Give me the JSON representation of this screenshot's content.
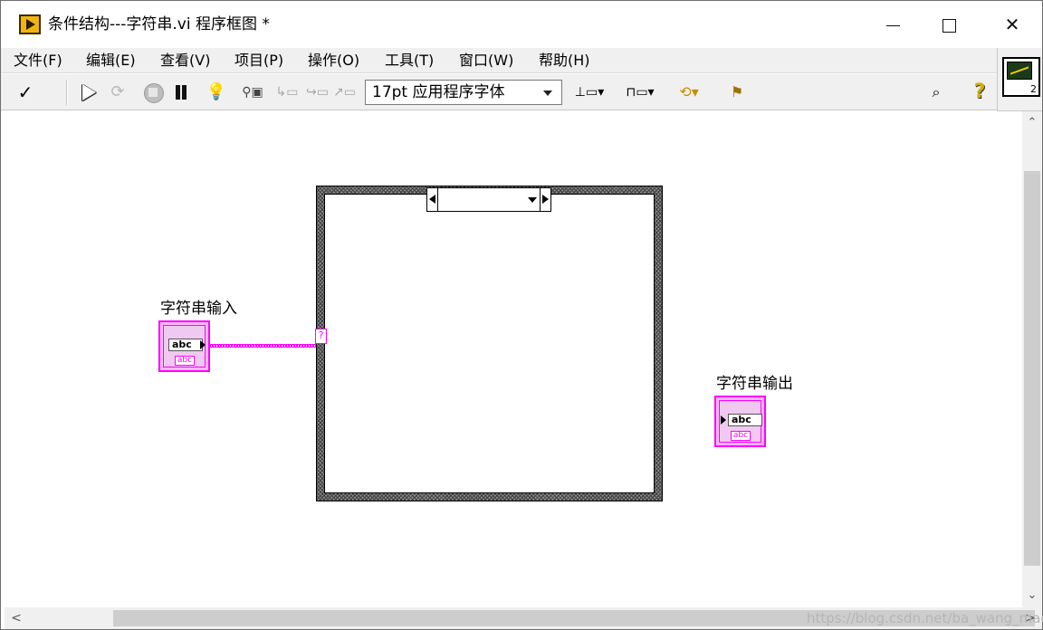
{
  "window": {
    "title": "条件结构---字符串.vi 程序框图 *"
  },
  "menu": {
    "items": [
      "文件(F)",
      "编辑(E)",
      "查看(V)",
      "项目(P)",
      "操作(O)",
      "工具(T)",
      "窗口(W)",
      "帮助(H)"
    ]
  },
  "toolbar": {
    "check_glyph": "✓",
    "font_select": "17pt 应用程序字体",
    "help_glyph": "?",
    "search_glyph": "⌕",
    "runcont_glyph": "⟳",
    "highlight_glyph": "💡",
    "retain_glyph": "⚲▣",
    "stepin_glyph": "↳▭",
    "stepover_glyph": "↪▭",
    "stepout_glyph": "↗▭",
    "align_glyph": "⊥▭▾",
    "distrib_glyph": "⊓▭▾",
    "cleanup_glyph": "⟲▾",
    "reorder_glyph": "⚑"
  },
  "vi_icon": {
    "number": "2"
  },
  "diagram": {
    "input_label": "字符串输入",
    "output_label": "字符串输出",
    "terminal_field_text": "abc",
    "terminal_sub_text": "abc",
    "selector_tunnel_text": "?",
    "selector_value": ""
  },
  "scrollbar": {
    "up": "⌃",
    "down": "⌄",
    "left": "<",
    "right": ">"
  },
  "watermark": "https://blog.csdn.net/ba_wang_mao"
}
